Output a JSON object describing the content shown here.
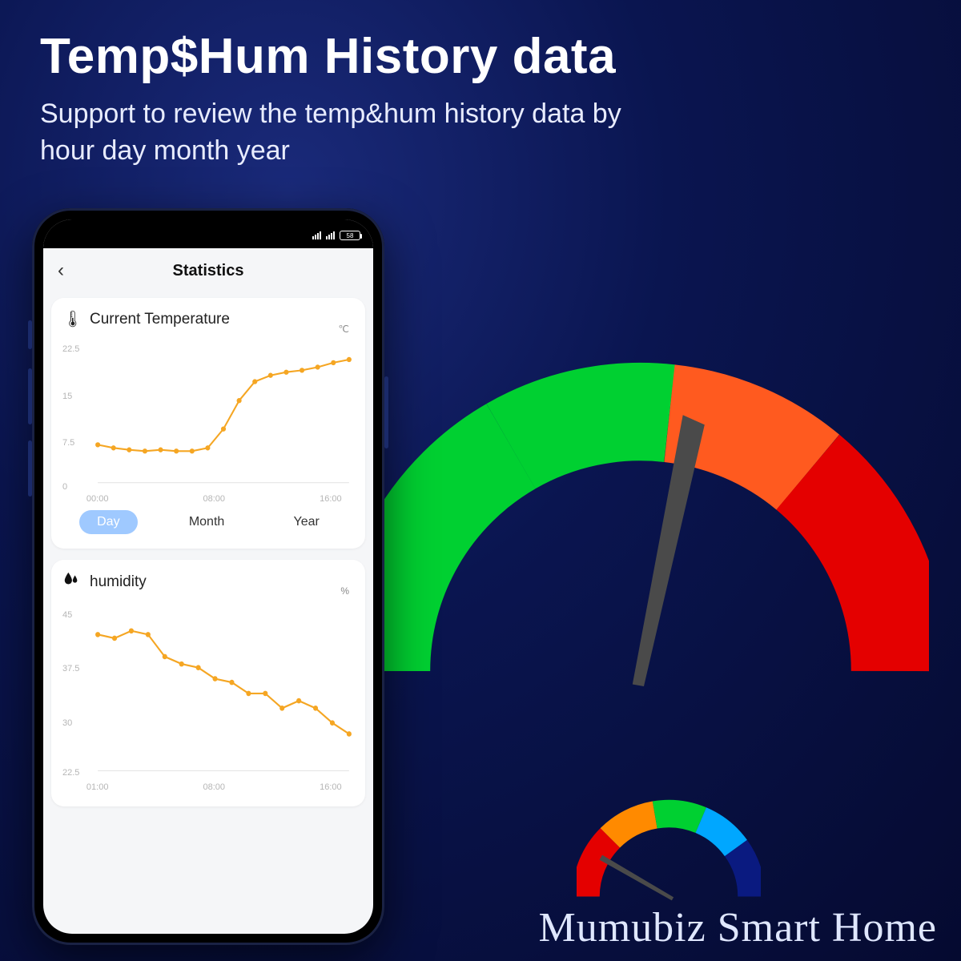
{
  "hero": {
    "title": "Temp$Hum History data",
    "subtitle": "Support to review the temp&hum history data by hour day month year"
  },
  "brand": "Mumubiz Smart Home",
  "status": {
    "battery": "58"
  },
  "app": {
    "title": "Statistics",
    "back_glyph": "‹"
  },
  "temp_card": {
    "label": "Current Temperature",
    "unit": "℃",
    "yticks": [
      "22.5",
      "15",
      "7.5",
      "0"
    ],
    "xticks": [
      "00:00",
      "08:00",
      "16:00"
    ]
  },
  "periods": {
    "day": "Day",
    "month": "Month",
    "year": "Year"
  },
  "hum_card": {
    "label": "humidity",
    "unit": "%",
    "yticks": [
      "45",
      "37.5",
      "30",
      "22.5"
    ],
    "xticks": [
      "01:00",
      "08:00",
      "16:00"
    ]
  },
  "chart_data": [
    {
      "type": "line",
      "title": "Current Temperature",
      "xlabel": "",
      "ylabel": "℃",
      "ylim": [
        0,
        22.5
      ],
      "x": [
        "00:00",
        "01:00",
        "02:00",
        "03:00",
        "04:00",
        "05:00",
        "06:00",
        "07:00",
        "08:00",
        "09:00",
        "10:00",
        "11:00",
        "12:00",
        "13:00",
        "14:00",
        "15:00",
        "16:00"
      ],
      "values": [
        6.0,
        5.5,
        5.2,
        5.0,
        5.2,
        5.0,
        5.0,
        5.5,
        8.5,
        13.0,
        16.0,
        17.0,
        17.5,
        17.8,
        18.3,
        19.0,
        19.5
      ]
    },
    {
      "type": "line",
      "title": "humidity",
      "xlabel": "",
      "ylabel": "%",
      "ylim": [
        22.5,
        45
      ],
      "x": [
        "01:00",
        "02:00",
        "03:00",
        "04:00",
        "05:00",
        "06:00",
        "07:00",
        "08:00",
        "09:00",
        "10:00",
        "11:00",
        "12:00",
        "13:00",
        "14:00",
        "15:00",
        "16:00"
      ],
      "values": [
        41.0,
        40.5,
        41.5,
        41.0,
        38.0,
        37.0,
        36.5,
        35.0,
        34.5,
        33.0,
        33.0,
        31.0,
        32.0,
        31.0,
        29.0,
        27.5
      ]
    }
  ]
}
